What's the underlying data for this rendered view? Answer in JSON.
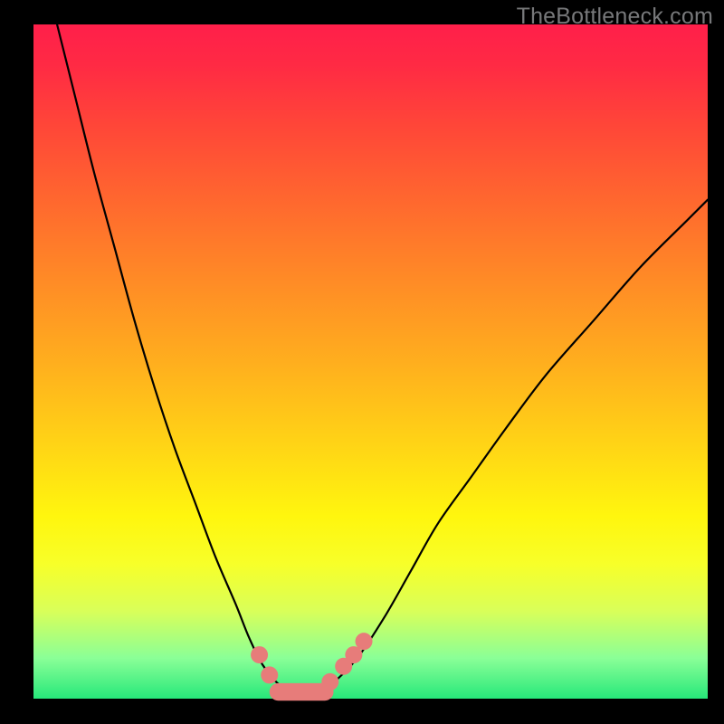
{
  "watermark": "TheBottleneck.com",
  "chart_data": {
    "type": "line",
    "title": "",
    "xlabel": "",
    "ylabel": "",
    "xlim": [
      0,
      100
    ],
    "ylim": [
      0,
      100
    ],
    "gradient_stops": [
      {
        "pos": 0.0,
        "color": "#ff1f4a"
      },
      {
        "pos": 0.5,
        "color": "#ffae1e"
      },
      {
        "pos": 0.8,
        "color": "#f7ff29"
      },
      {
        "pos": 1.0,
        "color": "#27e87a"
      }
    ],
    "series": [
      {
        "name": "bottleneck-curve",
        "color": "#000000",
        "x": [
          3,
          6,
          9,
          12,
          15,
          18,
          21,
          24,
          27,
          30,
          32,
          34,
          36.5,
          39,
          41,
          44,
          48,
          52,
          56,
          60,
          65,
          70,
          76,
          83,
          90,
          97,
          100
        ],
        "y": [
          102,
          90,
          78,
          67,
          56,
          46,
          37,
          29,
          21,
          14,
          9,
          5,
          2,
          0.5,
          0.5,
          2,
          6,
          12,
          19,
          26,
          33,
          40,
          48,
          56,
          64,
          71,
          74
        ]
      }
    ],
    "markers": {
      "name": "highlight-dots",
      "color": "#e77c7a",
      "bar_color": "#e77c7a",
      "points": [
        {
          "x": 33.5,
          "y": 6.5
        },
        {
          "x": 35.0,
          "y": 3.5
        },
        {
          "x": 38.0,
          "y": 1.0
        },
        {
          "x": 41.0,
          "y": 1.0
        },
        {
          "x": 44.0,
          "y": 2.5
        },
        {
          "x": 46.0,
          "y": 4.8
        },
        {
          "x": 47.5,
          "y": 6.5
        },
        {
          "x": 49.0,
          "y": 8.5
        }
      ],
      "bar": {
        "x1": 35.0,
        "x2": 44.5,
        "y": 1.0,
        "thickness": 2.6
      }
    }
  }
}
